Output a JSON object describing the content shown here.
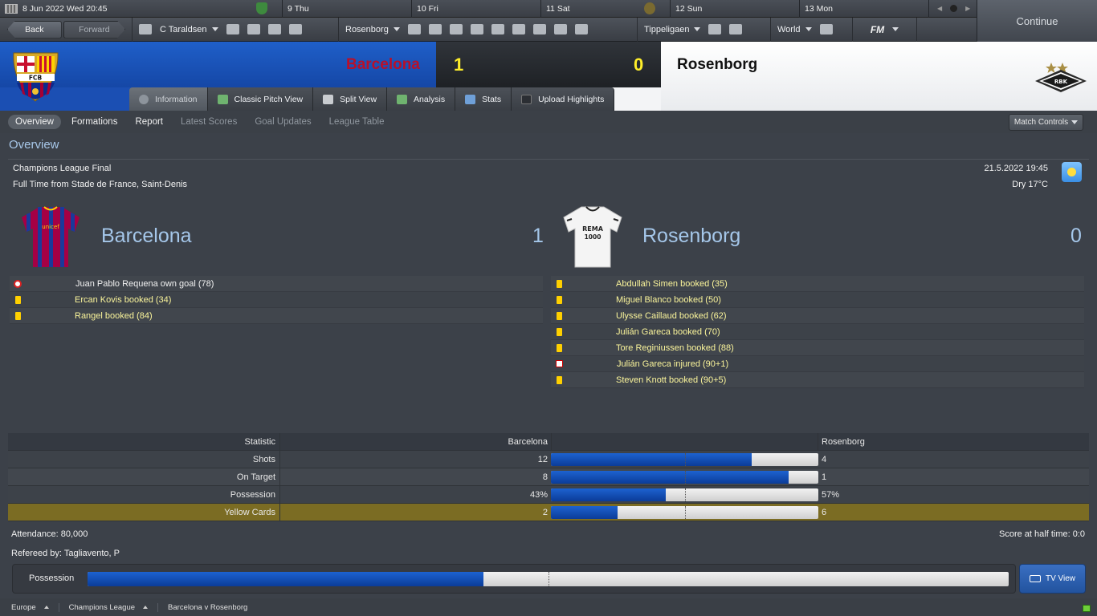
{
  "calendar": {
    "today": "8 Jun 2022  Wed 20:45",
    "days": [
      "9  Thu",
      "10  Fri",
      "11  Sat",
      "12  Sun",
      "13  Mon"
    ]
  },
  "continue_label": "Continue",
  "nav": {
    "back": "Back",
    "forward": "Forward",
    "manager": "C Taraldsen",
    "club": "Rosenborg",
    "league": "Tippeligaen",
    "world": "World",
    "fm": "FM"
  },
  "match": {
    "home_team": "Barcelona",
    "away_team": "Rosenborg",
    "home_score": "1",
    "away_score": "0"
  },
  "tabs": [
    "Information",
    "Classic Pitch View",
    "Split View",
    "Analysis",
    "Stats",
    "Upload Highlights"
  ],
  "subnav": [
    "Overview",
    "Formations",
    "Report",
    "Latest Scores",
    "Goal Updates",
    "League Table"
  ],
  "match_controls": "Match Controls",
  "overview": {
    "title": "Overview",
    "competition": "Champions League Final",
    "venue": "Full Time from Stade de France, Saint-Denis",
    "datetime": "21.5.2022 19:45",
    "weather": "Dry 17°C"
  },
  "home_events": [
    {
      "type": "goal",
      "text": "Juan Pablo Requena own goal (78)"
    },
    {
      "type": "yellow",
      "text": "Ercan Kovis booked (34)"
    },
    {
      "type": "yellow",
      "text": "Rangel booked (84)"
    }
  ],
  "away_events": [
    {
      "type": "yellow",
      "text": "Abdullah Simen booked (35)"
    },
    {
      "type": "yellow",
      "text": "Miguel Blanco booked (50)"
    },
    {
      "type": "yellow",
      "text": "Ulysse Caillaud booked (62)"
    },
    {
      "type": "yellow",
      "text": "Julián Gareca booked (70)"
    },
    {
      "type": "yellow",
      "text": "Tore Reginiussen booked (88)"
    },
    {
      "type": "injury",
      "text": "Julián Gareca injured (90+1)"
    },
    {
      "type": "yellow",
      "text": "Steven Knott booked (90+5)"
    }
  ],
  "stats": {
    "header": {
      "name": "Statistic",
      "home": "Barcelona",
      "away": "Rosenborg"
    },
    "rows": [
      {
        "name": "Shots",
        "home": "12",
        "away": "4",
        "home_fraction": 0.75
      },
      {
        "name": "On Target",
        "home": "8",
        "away": "1",
        "home_fraction": 0.889
      },
      {
        "name": "Possession",
        "home": "43%",
        "away": "57%",
        "home_fraction": 0.43
      },
      {
        "name": "Yellow Cards",
        "home": "2",
        "away": "6",
        "home_fraction": 0.25
      }
    ]
  },
  "attendance": "Attendance: 80,000",
  "halftime": "Score at half time: 0:0",
  "referee": "Refereed by: Tagliavento, P",
  "possession_bar": {
    "label": "Possession",
    "home_fraction": 0.43
  },
  "tv_view": "TV View",
  "breadcrumbs": [
    "Europe",
    "Champions League",
    "Barcelona v Rosenborg"
  ],
  "colors": {
    "home": "#1d4fb0",
    "away_badge": "#ffffff",
    "score": "#ffee2a",
    "booking": "#ffd000"
  }
}
